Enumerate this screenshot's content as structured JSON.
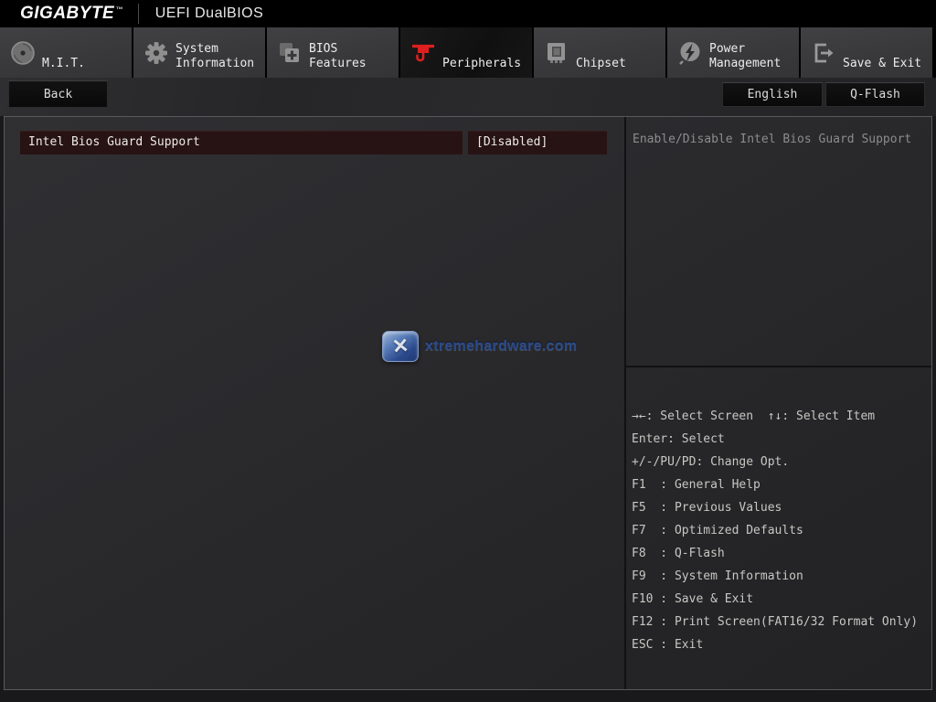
{
  "titlebar": {
    "brand": "GIGABYTE",
    "brand_tm": "™",
    "app_title": "UEFI DualBIOS"
  },
  "tabbar": {
    "tabs": [
      {
        "line1": "M.I.T.",
        "line2": ""
      },
      {
        "line1": "System",
        "line2": "Information"
      },
      {
        "line1": "BIOS",
        "line2": "Features"
      },
      {
        "line1": "Peripherals",
        "line2": ""
      },
      {
        "line1": "Chipset",
        "line2": ""
      },
      {
        "line1": "Power",
        "line2": "Management"
      },
      {
        "line1": "Save & Exit",
        "line2": ""
      }
    ],
    "active_tab": "Peripherals"
  },
  "toolbar": {
    "back_label": "Back",
    "language_label": "English",
    "qflash_label": "Q-Flash"
  },
  "main": {
    "setting": {
      "label": "Intel Bios Guard Support",
      "value": "[Disabled]"
    }
  },
  "help": {
    "description": "Enable/Disable Intel Bios Guard Support",
    "legend": [
      "→←: Select Screen  ↑↓: Select Item",
      "Enter: Select",
      "+/-/PU/PD: Change Opt.",
      "F1  : General Help",
      "F5  : Previous Values",
      "F7  : Optimized Defaults",
      "F8  : Q-Flash",
      "F9  : System Information",
      "F10 : Save & Exit",
      "F12 : Print Screen(FAT16/32 Format Only)",
      "ESC : Exit"
    ]
  },
  "watermark": {
    "x_glyph": "✕",
    "text": "xtremehardware.com"
  },
  "colors": {
    "accent_red": "#df1f1f",
    "highlight_row": "#271314",
    "tab_inactive": "#3a3a3c",
    "tab_active": "#121212"
  }
}
